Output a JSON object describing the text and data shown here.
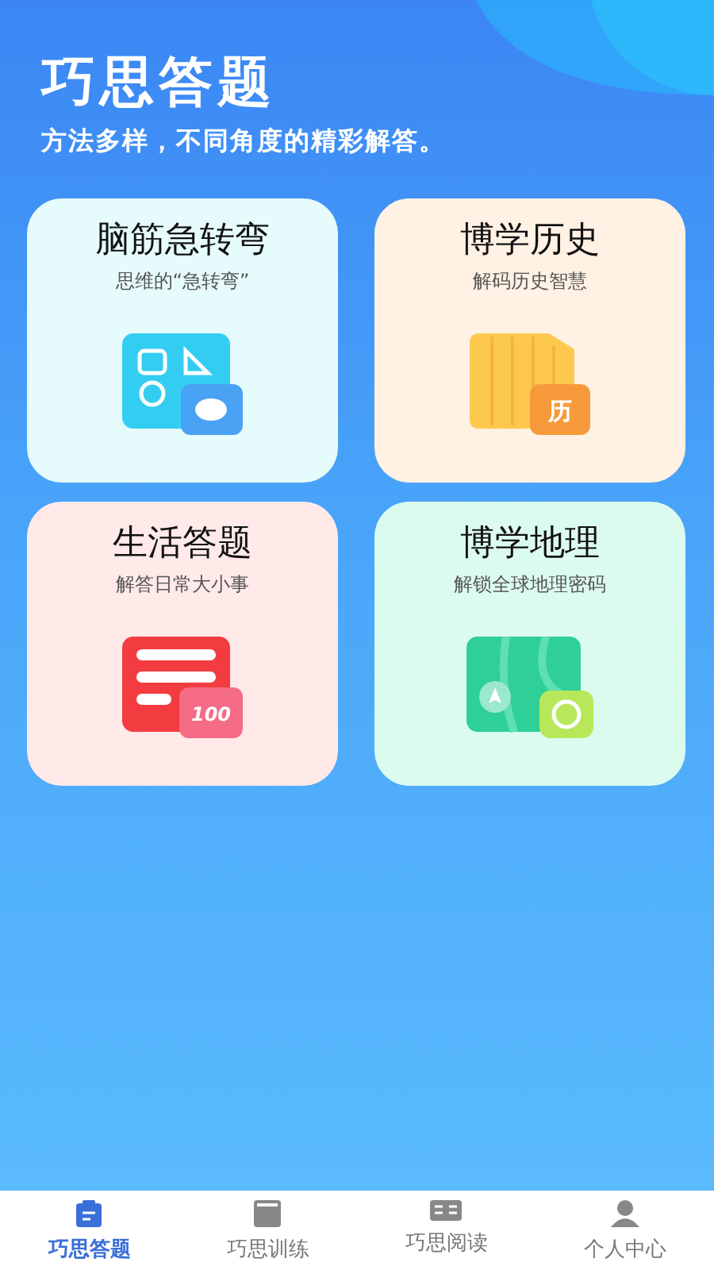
{
  "header": {
    "title": "巧思答题",
    "subtitle": "方法多样，不同角度的精彩解答。"
  },
  "cards": [
    {
      "kind": "brain",
      "title": "脑筋急转弯",
      "subtitle": "思维的“急转弯”"
    },
    {
      "kind": "history",
      "title": "博学历史",
      "subtitle": "解码历史智慧",
      "badge": "历"
    },
    {
      "kind": "life",
      "title": "生活答题",
      "subtitle": "解答日常大小事",
      "badge": "100"
    },
    {
      "kind": "geo",
      "title": "博学地理",
      "subtitle": "解锁全球地理密码"
    }
  ],
  "tabs": [
    {
      "kind": "quiz",
      "label": "巧思答题",
      "selected": true
    },
    {
      "kind": "train",
      "label": "巧思训练",
      "selected": false
    },
    {
      "kind": "read",
      "label": "巧思阅读",
      "selected": false
    },
    {
      "kind": "user",
      "label": "个人中心",
      "selected": false
    }
  ]
}
